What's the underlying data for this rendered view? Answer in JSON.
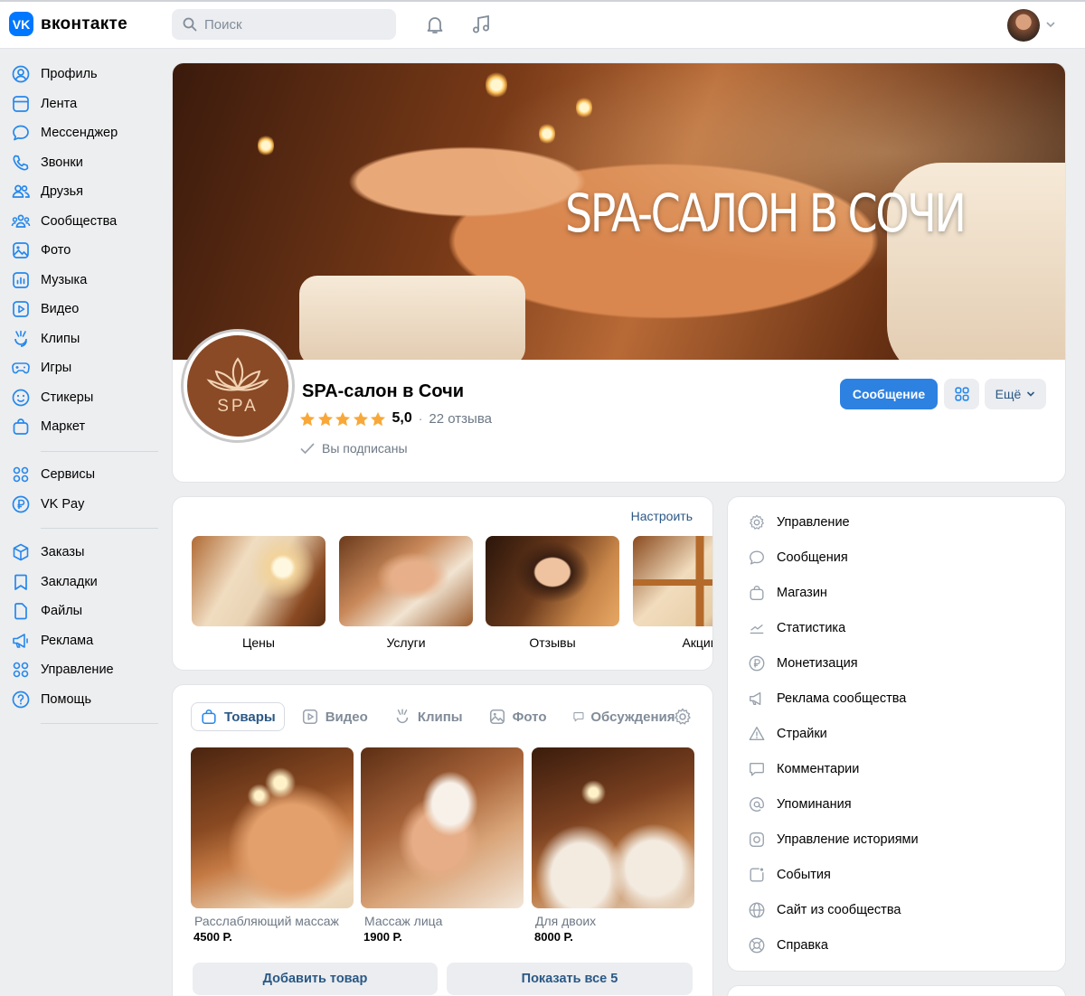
{
  "header": {
    "logo_text": "вконтакте",
    "search_placeholder": "Поиск",
    "icons": [
      "bell-icon",
      "music-icon"
    ]
  },
  "sidebar": {
    "items": [
      {
        "label": "Профиль",
        "icon": "user-icon"
      },
      {
        "label": "Лента",
        "icon": "feed-icon"
      },
      {
        "label": "Мессенджер",
        "icon": "message-icon"
      },
      {
        "label": "Звонки",
        "icon": "phone-icon"
      },
      {
        "label": "Друзья",
        "icon": "friends-icon"
      },
      {
        "label": "Сообщества",
        "icon": "communities-icon"
      },
      {
        "label": "Фото",
        "icon": "photo-icon"
      },
      {
        "label": "Музыка",
        "icon": "music-icon"
      },
      {
        "label": "Видео",
        "icon": "video-icon"
      },
      {
        "label": "Клипы",
        "icon": "clips-icon"
      },
      {
        "label": "Игры",
        "icon": "gamepad-icon"
      },
      {
        "label": "Стикеры",
        "icon": "smile-icon"
      },
      {
        "label": "Маркет",
        "icon": "bag-icon"
      },
      {
        "label": "Сервисы",
        "icon": "grid-icon"
      },
      {
        "label": "VK Pay",
        "icon": "ruble-icon"
      },
      {
        "label": "Заказы",
        "icon": "box-icon"
      },
      {
        "label": "Закладки",
        "icon": "bookmark-icon"
      },
      {
        "label": "Файлы",
        "icon": "file-icon"
      },
      {
        "label": "Реклама",
        "icon": "megaphone-icon"
      },
      {
        "label": "Управление",
        "icon": "grid-icon"
      },
      {
        "label": "Помощь",
        "icon": "help-icon"
      }
    ]
  },
  "cover": {
    "title": "SPA-САЛОН В СОЧИ"
  },
  "community": {
    "avatar_text": "SPA",
    "name": "SPA-салон в Сочи",
    "rating": "5,0",
    "reviews": "22 отзыва",
    "subscribed": "Вы подписаны",
    "btn_message": "Сообщение",
    "btn_more": "Ещё"
  },
  "links": {
    "setup": "Настроить",
    "tiles": [
      {
        "label": "Цены"
      },
      {
        "label": "Услуги"
      },
      {
        "label": "Отзывы"
      },
      {
        "label": "Акции"
      }
    ]
  },
  "goods": {
    "tabs": [
      {
        "label": "Товары",
        "icon": "bag-icon"
      },
      {
        "label": "Видео",
        "icon": "video-icon"
      },
      {
        "label": "Клипы",
        "icon": "clips-icon"
      },
      {
        "label": "Фото",
        "icon": "photo-icon"
      },
      {
        "label": "Обсуждения",
        "icon": "discussion-icon"
      }
    ],
    "products": [
      {
        "name": "Расслабляющий массаж",
        "price": "4500 Р."
      },
      {
        "name": "Массаж лица",
        "price": "1900 Р."
      },
      {
        "name": "Для двоих",
        "price": "8000 Р."
      }
    ],
    "btn_add": "Добавить товар",
    "btn_show_all": "Показать все 5"
  },
  "manage": {
    "items": [
      {
        "label": "Управление",
        "icon": "gear-icon"
      },
      {
        "label": "Сообщения",
        "icon": "message-icon"
      },
      {
        "label": "Магазин",
        "icon": "bag-icon"
      },
      {
        "label": "Статистика",
        "icon": "chart-icon"
      },
      {
        "label": "Монетизация",
        "icon": "ruble-icon"
      },
      {
        "label": "Реклама сообщества",
        "icon": "megaphone-icon"
      },
      {
        "label": "Страйки",
        "icon": "warning-icon"
      },
      {
        "label": "Комментарии",
        "icon": "comment-icon"
      },
      {
        "label": "Упоминания",
        "icon": "at-icon"
      },
      {
        "label": "Управление историями",
        "icon": "stories-icon"
      },
      {
        "label": "События",
        "icon": "event-icon"
      },
      {
        "label": "Сайт из сообщества",
        "icon": "globe-icon"
      },
      {
        "label": "Справка",
        "icon": "lifebuoy-icon"
      }
    ]
  },
  "colors": {
    "accent": "#2d81e0",
    "link": "#2a5885",
    "brand": "#0077ff",
    "star": "#f8a838"
  }
}
